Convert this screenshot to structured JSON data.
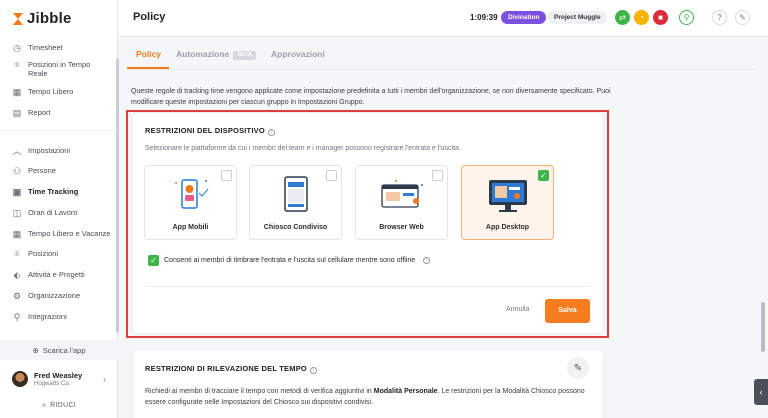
{
  "app": {
    "name": "Jibble",
    "brand_color": "#f07a1c"
  },
  "sidebar": {
    "items": [
      {
        "label": "Timesheet",
        "icon": "clock-icon"
      },
      {
        "label": "Posizioni in Tempo Reale",
        "icon": "location-pin-icon"
      },
      {
        "label": "Tempo Libero",
        "icon": "calendar-icon"
      },
      {
        "label": "Report",
        "icon": "report-icon"
      },
      {
        "label": "Impostazioni",
        "icon": "chevron-up-icon"
      },
      {
        "label": "Persone",
        "icon": "people-icon"
      },
      {
        "label": "Time Tracking",
        "icon": "time-tracking-icon",
        "active": true
      },
      {
        "label": "Orari di Lavoro",
        "icon": "work-schedule-icon"
      },
      {
        "label": "Tempo Libero e Vacanze",
        "icon": "calendar-icon"
      },
      {
        "label": "Posizioni",
        "icon": "location-pin-icon"
      },
      {
        "label": "Attività e Progetti",
        "icon": "tag-icon"
      },
      {
        "label": "Organizzazione",
        "icon": "gear-icon"
      },
      {
        "label": "Integrazioni",
        "icon": "integration-icon"
      }
    ],
    "download_label": "Scarica l'app",
    "user": {
      "name": "Fred Weasley",
      "org": "Hogwarts Co."
    },
    "collapse_label": "RIDUCI"
  },
  "header": {
    "title": "Policy",
    "timer": "1:09:39",
    "activity_pill": "Divination",
    "project_pill": "Project Muggle",
    "colors": {
      "activity": "#7b4fe0",
      "green": "#3fb549",
      "yellow": "#f5b400",
      "red": "#d92d3a"
    }
  },
  "tabs": [
    {
      "label": "Policy",
      "active": true
    },
    {
      "label": "Automazione",
      "badge": "BETA"
    },
    {
      "label": "Approvazioni"
    }
  ],
  "intro": "Queste regole di tracking time vengono applicate come impostazione predefinita a tutti i membri dell'organizzazione, se non diversamente specificato. Puoi modificare queste impostazioni per ciascun gruppo in Impostazioni Gruppo.",
  "device_card": {
    "title": "RESTRIZIONI DEL DISPOSITIVO",
    "subtitle": "Selezionare le piattaforme da cui i membri del team e i manager possono registrare l'entrata e l'uscita.",
    "devices": [
      {
        "label": "App Mobili",
        "checked": false
      },
      {
        "label": "Chiosco Condiviso",
        "checked": false
      },
      {
        "label": "Browser Web",
        "checked": false
      },
      {
        "label": "App Desktop",
        "checked": true
      }
    ],
    "offline_label": "Consenti ai membri di timbrare l'entrata e l'uscita sul cellulare mentre sono offline",
    "cancel_label": "Annulla",
    "save_label": "Salva"
  },
  "tracking_card": {
    "title": "RESTRIZIONI DI RILEVAZIONE DEL TEMPO",
    "text_before": "Richiedi ai membri di tracciare il tempo con metodi di verifica aggiuntivi in ",
    "text_bold": "Modalità Personale",
    "text_after": ". Le restrizioni per la Modalità Chiosco possono essere configurate nelle Impostazioni del Chiosco sui dispositivi condivisi."
  }
}
